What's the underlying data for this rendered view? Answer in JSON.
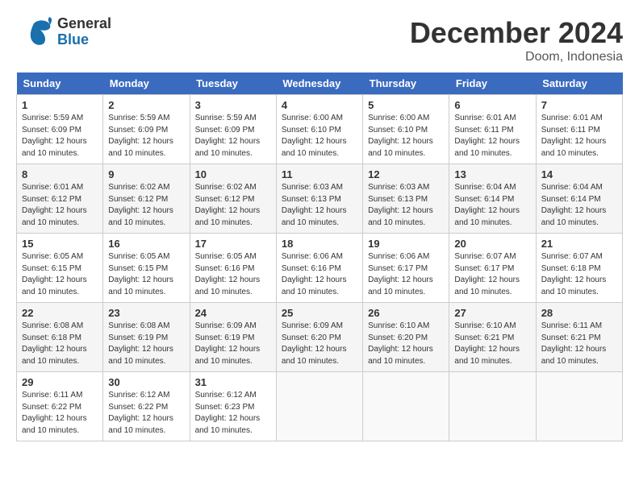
{
  "header": {
    "logo_general": "General",
    "logo_blue": "Blue",
    "month": "December 2024",
    "location": "Doom, Indonesia"
  },
  "calendar": {
    "days_of_week": [
      "Sunday",
      "Monday",
      "Tuesday",
      "Wednesday",
      "Thursday",
      "Friday",
      "Saturday"
    ],
    "weeks": [
      [
        {
          "num": "1",
          "sunrise": "5:59 AM",
          "sunset": "6:09 PM",
          "daylight": "12 hours and 10 minutes."
        },
        {
          "num": "2",
          "sunrise": "5:59 AM",
          "sunset": "6:09 PM",
          "daylight": "12 hours and 10 minutes."
        },
        {
          "num": "3",
          "sunrise": "5:59 AM",
          "sunset": "6:09 PM",
          "daylight": "12 hours and 10 minutes."
        },
        {
          "num": "4",
          "sunrise": "6:00 AM",
          "sunset": "6:10 PM",
          "daylight": "12 hours and 10 minutes."
        },
        {
          "num": "5",
          "sunrise": "6:00 AM",
          "sunset": "6:10 PM",
          "daylight": "12 hours and 10 minutes."
        },
        {
          "num": "6",
          "sunrise": "6:01 AM",
          "sunset": "6:11 PM",
          "daylight": "12 hours and 10 minutes."
        },
        {
          "num": "7",
          "sunrise": "6:01 AM",
          "sunset": "6:11 PM",
          "daylight": "12 hours and 10 minutes."
        }
      ],
      [
        {
          "num": "8",
          "sunrise": "6:01 AM",
          "sunset": "6:12 PM",
          "daylight": "12 hours and 10 minutes."
        },
        {
          "num": "9",
          "sunrise": "6:02 AM",
          "sunset": "6:12 PM",
          "daylight": "12 hours and 10 minutes."
        },
        {
          "num": "10",
          "sunrise": "6:02 AM",
          "sunset": "6:12 PM",
          "daylight": "12 hours and 10 minutes."
        },
        {
          "num": "11",
          "sunrise": "6:03 AM",
          "sunset": "6:13 PM",
          "daylight": "12 hours and 10 minutes."
        },
        {
          "num": "12",
          "sunrise": "6:03 AM",
          "sunset": "6:13 PM",
          "daylight": "12 hours and 10 minutes."
        },
        {
          "num": "13",
          "sunrise": "6:04 AM",
          "sunset": "6:14 PM",
          "daylight": "12 hours and 10 minutes."
        },
        {
          "num": "14",
          "sunrise": "6:04 AM",
          "sunset": "6:14 PM",
          "daylight": "12 hours and 10 minutes."
        }
      ],
      [
        {
          "num": "15",
          "sunrise": "6:05 AM",
          "sunset": "6:15 PM",
          "daylight": "12 hours and 10 minutes."
        },
        {
          "num": "16",
          "sunrise": "6:05 AM",
          "sunset": "6:15 PM",
          "daylight": "12 hours and 10 minutes."
        },
        {
          "num": "17",
          "sunrise": "6:05 AM",
          "sunset": "6:16 PM",
          "daylight": "12 hours and 10 minutes."
        },
        {
          "num": "18",
          "sunrise": "6:06 AM",
          "sunset": "6:16 PM",
          "daylight": "12 hours and 10 minutes."
        },
        {
          "num": "19",
          "sunrise": "6:06 AM",
          "sunset": "6:17 PM",
          "daylight": "12 hours and 10 minutes."
        },
        {
          "num": "20",
          "sunrise": "6:07 AM",
          "sunset": "6:17 PM",
          "daylight": "12 hours and 10 minutes."
        },
        {
          "num": "21",
          "sunrise": "6:07 AM",
          "sunset": "6:18 PM",
          "daylight": "12 hours and 10 minutes."
        }
      ],
      [
        {
          "num": "22",
          "sunrise": "6:08 AM",
          "sunset": "6:18 PM",
          "daylight": "12 hours and 10 minutes."
        },
        {
          "num": "23",
          "sunrise": "6:08 AM",
          "sunset": "6:19 PM",
          "daylight": "12 hours and 10 minutes."
        },
        {
          "num": "24",
          "sunrise": "6:09 AM",
          "sunset": "6:19 PM",
          "daylight": "12 hours and 10 minutes."
        },
        {
          "num": "25",
          "sunrise": "6:09 AM",
          "sunset": "6:20 PM",
          "daylight": "12 hours and 10 minutes."
        },
        {
          "num": "26",
          "sunrise": "6:10 AM",
          "sunset": "6:20 PM",
          "daylight": "12 hours and 10 minutes."
        },
        {
          "num": "27",
          "sunrise": "6:10 AM",
          "sunset": "6:21 PM",
          "daylight": "12 hours and 10 minutes."
        },
        {
          "num": "28",
          "sunrise": "6:11 AM",
          "sunset": "6:21 PM",
          "daylight": "12 hours and 10 minutes."
        }
      ],
      [
        {
          "num": "29",
          "sunrise": "6:11 AM",
          "sunset": "6:22 PM",
          "daylight": "12 hours and 10 minutes."
        },
        {
          "num": "30",
          "sunrise": "6:12 AM",
          "sunset": "6:22 PM",
          "daylight": "12 hours and 10 minutes."
        },
        {
          "num": "31",
          "sunrise": "6:12 AM",
          "sunset": "6:23 PM",
          "daylight": "12 hours and 10 minutes."
        },
        null,
        null,
        null,
        null
      ]
    ]
  }
}
